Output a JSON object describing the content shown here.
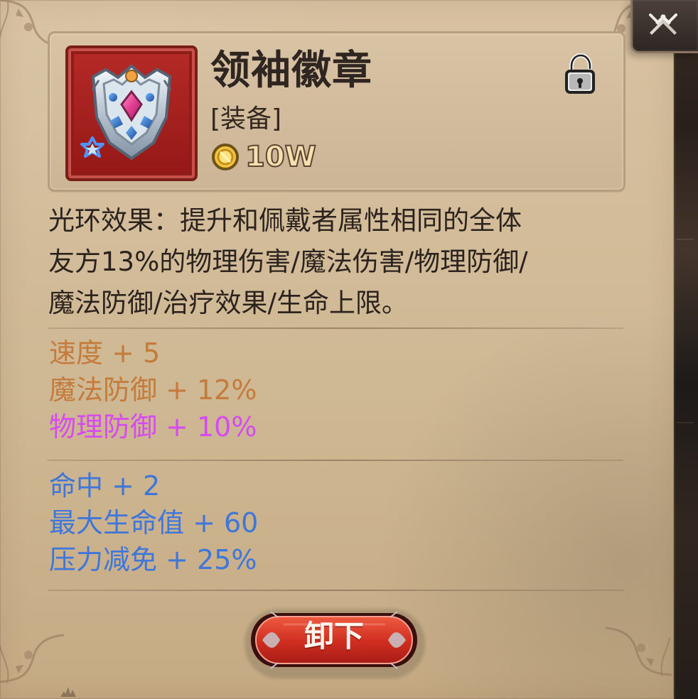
{
  "item": {
    "name": "领袖徽章",
    "type": "[装备]",
    "price": "10W",
    "description": "光环效果：提升和佩戴者属性相同的全体\n友方13%的物理伤害/魔法伤害/物理防御/\n魔法防御/治疗效果/生命上限。",
    "icons": {
      "item": "leader-badge-icon",
      "rank": "star-rank-icon",
      "lock": "lock-icon",
      "coin": "coin-icon",
      "corner": "crossed-swords-icon"
    }
  },
  "stats": {
    "group_1": [
      {
        "label": "速度 + 5",
        "color": "#c47b3b"
      },
      {
        "label": "魔法防御 + 12%",
        "color": "#c47b3b"
      },
      {
        "label": "物理防御 + 10%",
        "color": "#d64af2"
      }
    ],
    "group_2": [
      {
        "label": "命中 + 2",
        "color": "#3f76da"
      },
      {
        "label": "最大生命值 + 60",
        "color": "#3f76da"
      },
      {
        "label": "压力减免 + 25%",
        "color": "#3f76da"
      }
    ]
  },
  "actions": {
    "unequip": "卸下"
  },
  "colors": {
    "panel": "#d2bc99",
    "frame_red": "#a91f1c",
    "text_dark": "#2d231e",
    "orange_stat": "#c47b3b",
    "purple_stat": "#d64af2",
    "blue_stat": "#3f76da"
  }
}
